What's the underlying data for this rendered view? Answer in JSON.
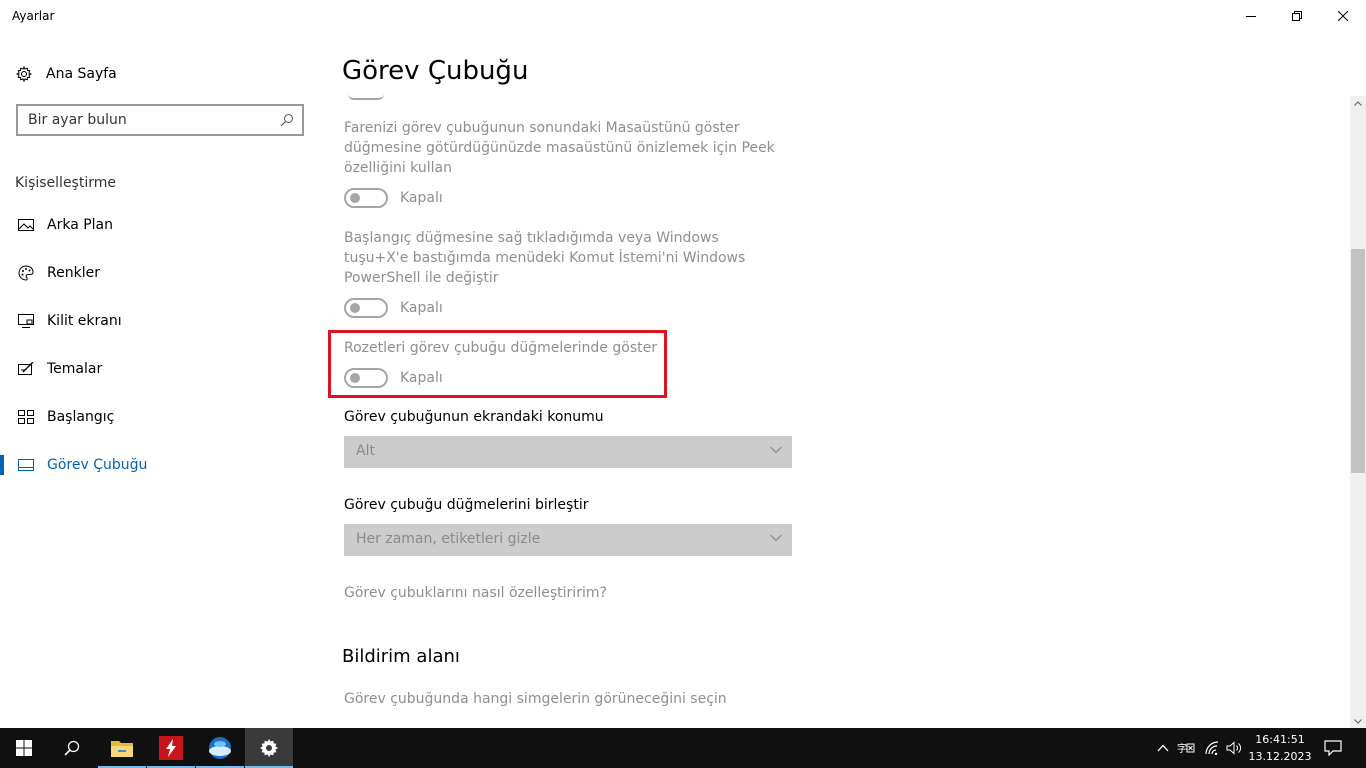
{
  "window": {
    "title": "Ayarlar"
  },
  "sidebar": {
    "home_label": "Ana Sayfa",
    "search_placeholder": "Bir ayar bulun",
    "section_label": "Kişiselleştirme",
    "items": [
      {
        "label": "Arka Plan",
        "icon": "image-icon"
      },
      {
        "label": "Renkler",
        "icon": "palette-icon"
      },
      {
        "label": "Kilit ekranı",
        "icon": "lock-screen-icon"
      },
      {
        "label": "Temalar",
        "icon": "themes-icon"
      },
      {
        "label": "Başlangıç",
        "icon": "start-icon"
      },
      {
        "label": "Görev Çubuğu",
        "icon": "taskbar-icon",
        "active": true
      }
    ]
  },
  "main": {
    "title": "Görev Çubuğu",
    "settings": [
      {
        "description": "Farenizi görev çubuğunun sonundaki Masaüstünü göster düğmesine götürdüğünüzde masaüstünü önizlemek için Peek özelliğini kullan",
        "state": "Kapalı",
        "enabled": false
      },
      {
        "description": "Başlangıç düğmesine sağ tıkladığımda veya Windows tuşu+X'e bastığımda menüdeki Komut İstemi'ni Windows PowerShell ile değiştir",
        "state": "Kapalı",
        "enabled": false
      },
      {
        "description": "Rozetleri görev çubuğu düğmelerinde göster",
        "state": "Kapalı",
        "enabled": false
      }
    ],
    "location": {
      "label": "Görev çubuğunun ekrandaki konumu",
      "value": "Alt"
    },
    "combine": {
      "label": "Görev çubuğu düğmelerini birleştir",
      "value": "Her zaman, etiketleri gizle"
    },
    "help_link": "Görev çubuklarını nasıl özelleştiririm?",
    "notification_area": {
      "title": "Bildirim alanı",
      "link": "Görev çubuğunda hangi simgelerin görüneceğini seçin"
    }
  },
  "colors": {
    "accent": "#0063b1",
    "highlight": "#e0111e",
    "taskbar": "#101010"
  },
  "taskbar": {
    "apps": [
      "start-icon",
      "search-icon",
      "file-explorer-icon",
      "flash-app-icon",
      "browser-icon",
      "settings-icon"
    ],
    "clock_time": "16:41:51",
    "clock_date": "13.12.2023"
  }
}
